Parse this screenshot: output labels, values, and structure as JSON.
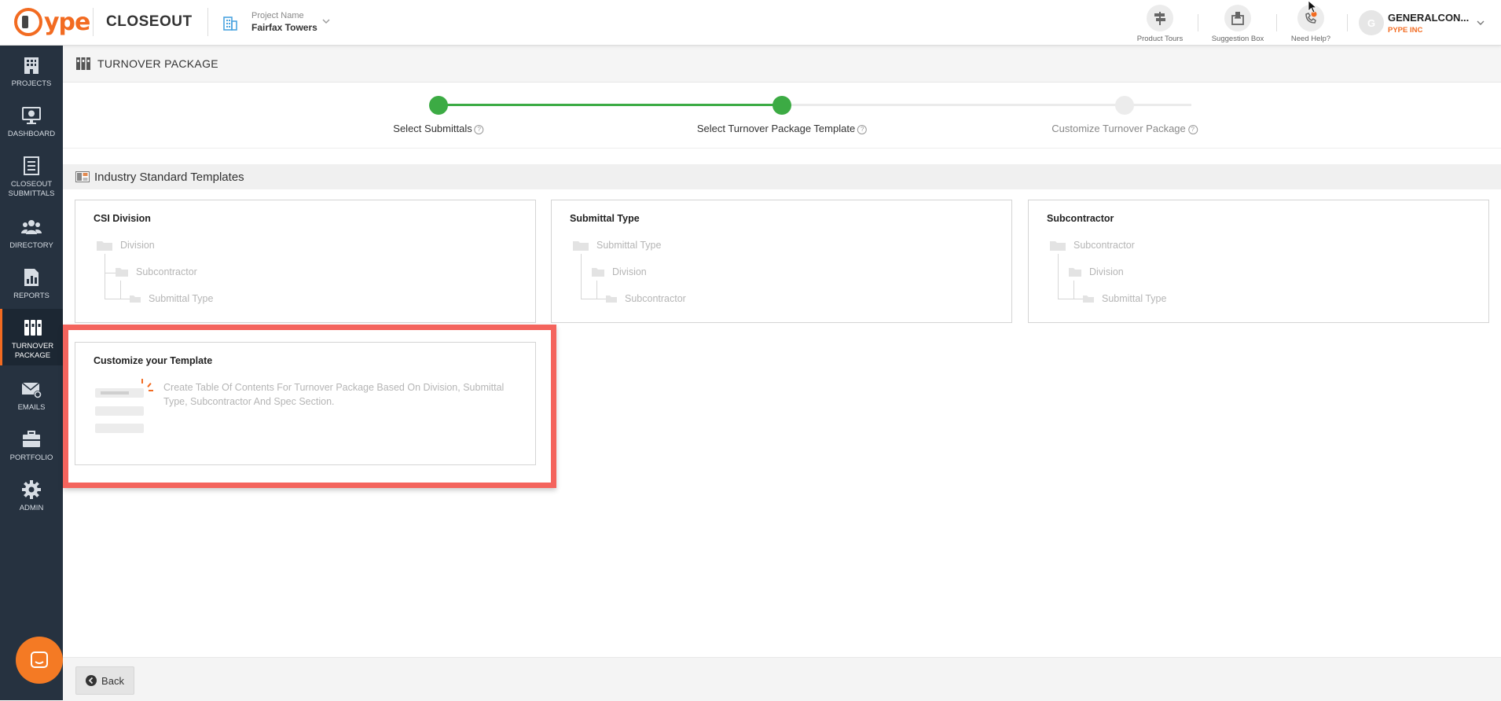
{
  "header": {
    "app_name": "CLOSEOUT",
    "logo_text": "ype",
    "project_label": "Project Name",
    "project_name": "Fairfax Towers",
    "tools": [
      {
        "label": "Product Tours",
        "icon": "signpost-icon"
      },
      {
        "label": "Suggestion Box",
        "icon": "suggestion-box-icon"
      },
      {
        "label": "Need Help?",
        "icon": "phone-help-icon"
      }
    ],
    "user": {
      "initial": "G",
      "name": "GENERALCON...",
      "org": "PYPE INC"
    }
  },
  "sidebar": {
    "items": [
      {
        "label": "PROJECTS",
        "icon": "building-icon"
      },
      {
        "label": "DASHBOARD",
        "icon": "monitor-chart-icon"
      },
      {
        "label": "CLOSEOUT SUBMITTALS",
        "icon": "document-list-icon"
      },
      {
        "label": "DIRECTORY",
        "icon": "people-icon"
      },
      {
        "label": "REPORTS",
        "icon": "report-chart-icon"
      },
      {
        "label": "TURNOVER PACKAGE",
        "icon": "binders-icon",
        "active": true
      },
      {
        "label": "EMAILS",
        "icon": "email-gear-icon"
      },
      {
        "label": "PORTFOLIO",
        "icon": "briefcase-icon"
      },
      {
        "label": "ADMIN",
        "icon": "gear-icon"
      }
    ]
  },
  "page": {
    "title": "TURNOVER PACKAGE"
  },
  "stepper": {
    "steps": [
      {
        "label": "Select Submittals",
        "state": "complete"
      },
      {
        "label": "Select Turnover Package Template",
        "state": "current"
      },
      {
        "label": "Customize Turnover Package",
        "state": "pending"
      }
    ],
    "active_color": "#3cab44",
    "pending_color": "#e9e9e9"
  },
  "templates": {
    "section_title": "Industry Standard Templates",
    "cards": [
      {
        "title": "CSI Division",
        "levels": [
          "Division",
          "Subcontractor",
          "Submittal Type"
        ]
      },
      {
        "title": "Submittal Type",
        "levels": [
          "Submittal Type",
          "Division",
          "Subcontractor"
        ]
      },
      {
        "title": "Subcontractor",
        "levels": [
          "Subcontractor",
          "Division",
          "Submittal Type"
        ]
      }
    ],
    "custom": {
      "title": "Customize your Template",
      "description": "Create Table Of Contents For Turnover Package Based On Division, Submittal Type, Subcontractor And Spec Section."
    }
  },
  "footer": {
    "back_label": "Back"
  },
  "colors": {
    "brand": "#f26b21",
    "sidebar_bg": "#263240",
    "highlight": "#f4645d"
  }
}
